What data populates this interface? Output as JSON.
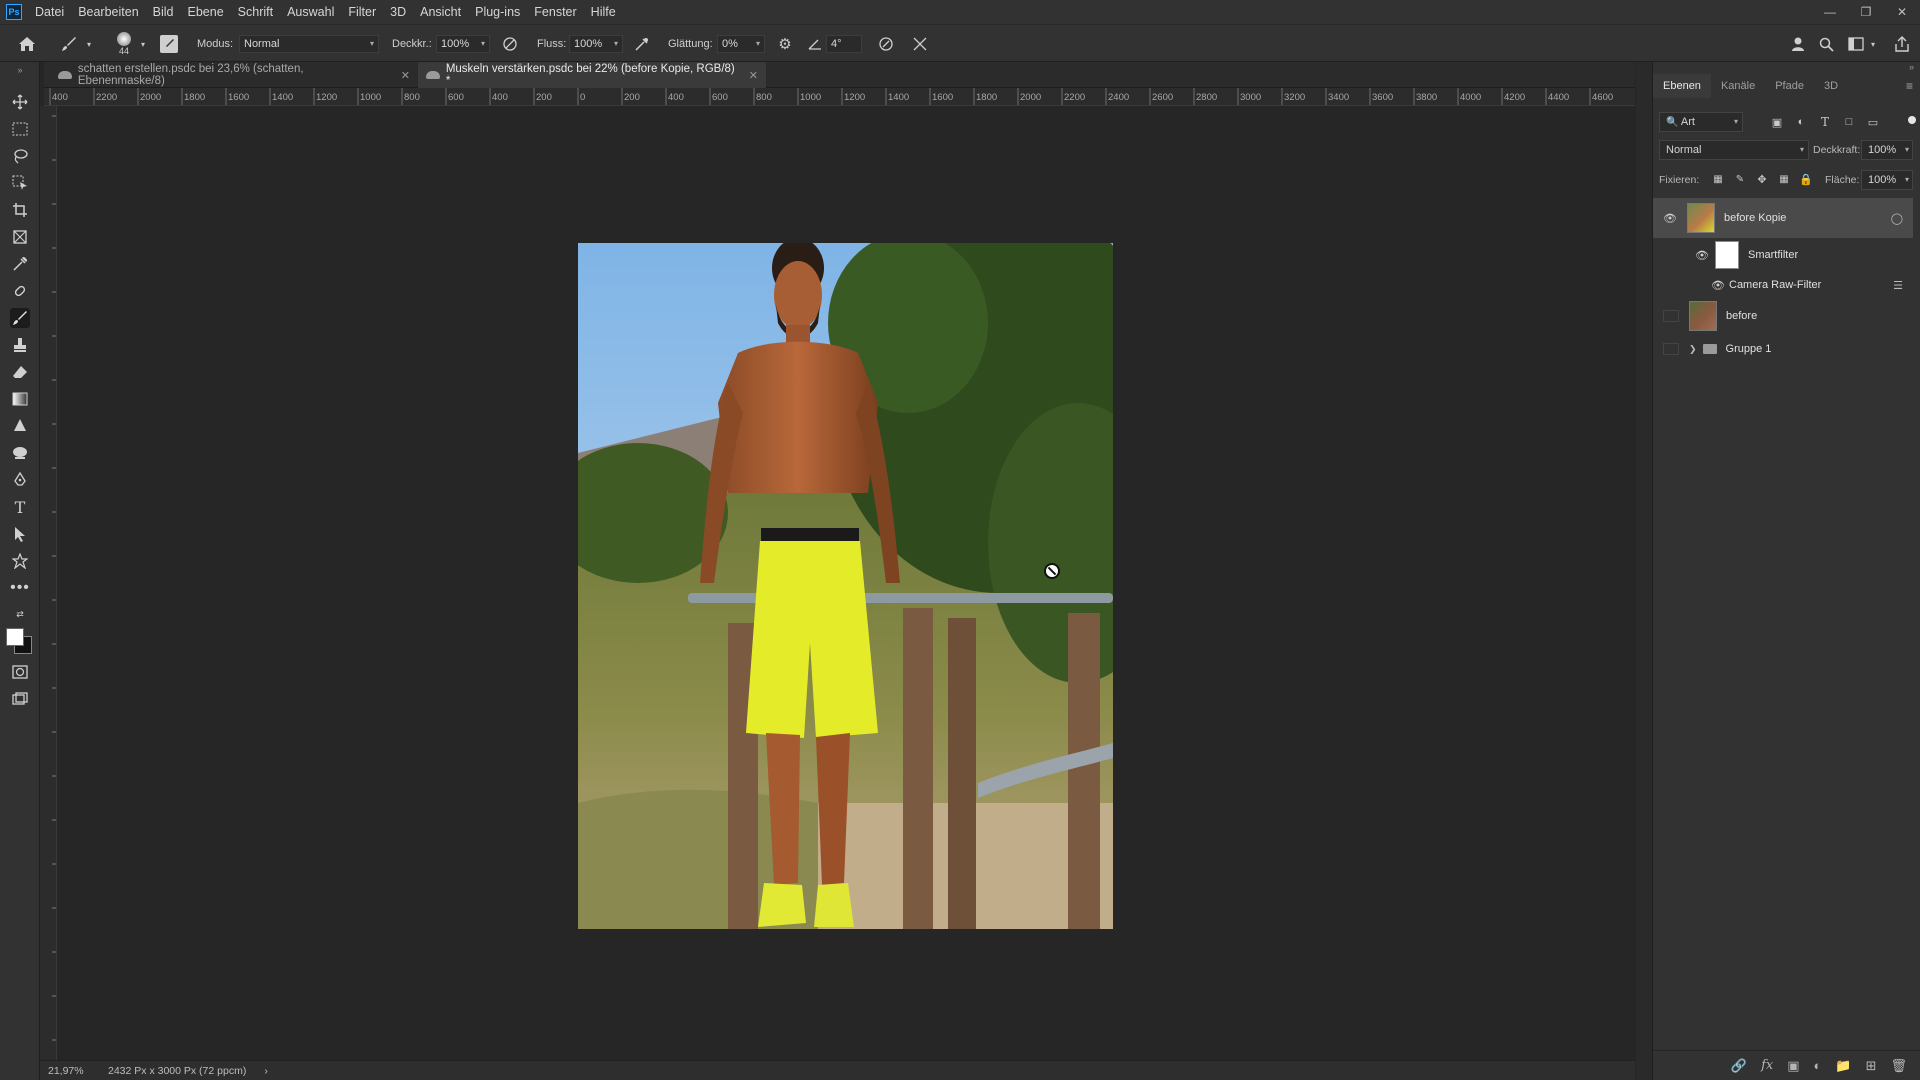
{
  "menubar": {
    "logo": "Ps",
    "items": [
      "Datei",
      "Bearbeiten",
      "Bild",
      "Ebene",
      "Schrift",
      "Auswahl",
      "Filter",
      "3D",
      "Ansicht",
      "Plug-ins",
      "Fenster",
      "Hilfe"
    ]
  },
  "options": {
    "brush_size": "44",
    "mode_label": "Modus:",
    "mode_value": "Normal",
    "opacity_label": "Deckkr.:",
    "opacity_value": "100%",
    "flow_label": "Fluss:",
    "flow_value": "100%",
    "smoothing_label": "Glättung:",
    "smoothing_value": "0%",
    "angle_value": "4°"
  },
  "tabs": [
    {
      "label": "schatten erstellen.psdc bei 23,6% (schatten, Ebenenmaske/8)",
      "active": false
    },
    {
      "label": "Muskeln verstärken.psdc bei 22% (before Kopie, RGB/8) *",
      "active": true
    }
  ],
  "ruler_top": [
    "400",
    "2200",
    "2000",
    "1800",
    "1600",
    "1400",
    "1200",
    "1000",
    "800",
    "600",
    "400",
    "200",
    "0",
    "200",
    "400",
    "600",
    "800",
    "1000",
    "1200",
    "1400",
    "1600",
    "1800",
    "2000",
    "2200",
    "2400",
    "2600",
    "2800",
    "3000",
    "3200",
    "3400",
    "3600",
    "3800",
    "4000",
    "4200",
    "4400",
    "4600"
  ],
  "status": {
    "zoom": "21,97%",
    "doc_info": "2432 Px x 3000 Px (72 ppcm)",
    "arrow": "›"
  },
  "panel": {
    "tabs": [
      "Ebenen",
      "Kanäle",
      "Pfade",
      "3D"
    ],
    "filter_label": "Art",
    "blend_mode": "Normal",
    "opacity_label": "Deckkraft:",
    "opacity_value": "100%",
    "lock_label": "Fixieren:",
    "fill_label": "Fläche:",
    "fill_value": "100%",
    "layers": [
      {
        "name": "before Kopie",
        "visible": true,
        "selected": true
      },
      {
        "name": "Smartfilter",
        "visible": true,
        "sub": true
      },
      {
        "name": "Camera Raw-Filter",
        "visible": true,
        "sub": true
      },
      {
        "name": "before",
        "visible": false
      },
      {
        "name": "Gruppe 1",
        "visible": false,
        "group": true
      }
    ]
  },
  "colors": {
    "accent": "#31a8ff",
    "ui_bg": "#323232",
    "canvas_bg": "#262626",
    "selection": "#4a4a4a"
  },
  "icons": [
    "home-icon",
    "brush-icon",
    "move-icon",
    "marquee-icon",
    "lasso-icon",
    "crop-icon",
    "eyedropper-icon",
    "healing-icon",
    "stamp-icon",
    "eraser-icon",
    "gradient-icon",
    "pen-icon",
    "text-icon",
    "path-select-icon",
    "hand-icon",
    "eye-icon",
    "folder-icon",
    "trash-icon"
  ]
}
